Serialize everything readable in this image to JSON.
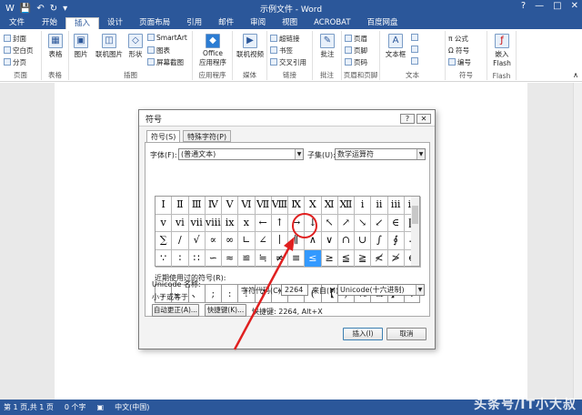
{
  "app": {
    "title": "示例文件 - Word",
    "window_buttons": [
      "?",
      "—",
      "□",
      "✕"
    ]
  },
  "tabs": [
    {
      "label": "文件"
    },
    {
      "label": "开始"
    },
    {
      "label": "插入"
    },
    {
      "label": "设计"
    },
    {
      "label": "页面布局"
    },
    {
      "label": "引用"
    },
    {
      "label": "邮件"
    },
    {
      "label": "审阅"
    },
    {
      "label": "视图"
    },
    {
      "label": "ACROBAT"
    },
    {
      "label": "百度网盘"
    }
  ],
  "ribbon": {
    "pages": {
      "name": "页面",
      "cover": "封面",
      "blank": "空白页",
      "break": "分页"
    },
    "table": {
      "name": "表格",
      "label": "表格"
    },
    "illus": {
      "name": "插图",
      "picture": "图片",
      "online_picture": "联机图片",
      "shapes": "形状",
      "smartart": "SmartArt",
      "chart": "图表",
      "screenshot": "屏幕截图"
    },
    "apps": {
      "name": "应用程序",
      "office": "Office",
      "office2": "应用程序"
    },
    "media": {
      "name": "媒体",
      "online_video": "联机视频"
    },
    "links": {
      "name": "链接",
      "hyperlink": "超链接",
      "bookmark": "书签",
      "crossref": "交叉引用"
    },
    "comments": {
      "name": "批注",
      "comment": "批注"
    },
    "hf": {
      "name": "页眉和页脚",
      "header": "页眉",
      "footer": "页脚",
      "pagenum": "页码"
    },
    "text": {
      "name": "文本",
      "textbox": "文本框"
    },
    "symbols": {
      "name": "符号",
      "equation": "公式",
      "symbol": "符号",
      "number": "编号"
    },
    "flash": {
      "name": "Flash",
      "embed": "嵌入",
      "flash": "Flash"
    }
  },
  "dialog": {
    "title": "符号",
    "help": "?",
    "close": "✕",
    "tab_symbols": "符号(S)",
    "tab_special": "特殊字符(P)",
    "font_label": "字体(F):",
    "font_value": "(普通文本)",
    "subset_label": "子集(U):",
    "subset_value": "数学运算符",
    "grid_rows": [
      [
        "Ⅰ",
        "Ⅱ",
        "Ⅲ",
        "Ⅳ",
        "Ⅴ",
        "Ⅵ",
        "Ⅶ",
        "Ⅷ",
        "Ⅸ",
        "Ⅹ",
        "Ⅺ",
        "Ⅻ",
        "ⅰ",
        "ⅱ",
        "ⅲ",
        "ⅳ"
      ],
      [
        "ⅴ",
        "ⅵ",
        "ⅶ",
        "ⅷ",
        "ⅸ",
        "ⅹ",
        "←",
        "↑",
        "→",
        "↓",
        "↖",
        "↗",
        "↘",
        "↙",
        "∈",
        "∏"
      ],
      [
        "∑",
        "∕",
        "√",
        "∝",
        "∞",
        "∟",
        "∠",
        "∣",
        "∥",
        "∧",
        "∨",
        "∩",
        "∪",
        "∫",
        "∮",
        "∴"
      ],
      [
        "∵",
        "∶",
        "∷",
        "∽",
        "≈",
        "≌",
        "≒",
        "≠",
        "≡",
        "≤",
        "≥",
        "≦",
        "≧",
        "≮",
        "≯",
        "⊕"
      ]
    ],
    "recent_label": "近期使用过的符号(R):",
    "recent": [
      ",",
      "。",
      "、",
      ";",
      ":",
      "!",
      "?",
      "“",
      "”",
      "(",
      "【",
      ")",
      "%",
      "&",
      "】",
      "※"
    ],
    "unicode_name_label": "Unicode 名称:",
    "unicode_name": "小于或等于",
    "charcode_label": "字符代码(C):",
    "charcode": "2264",
    "from_label": "来自(M):",
    "from_value": "Unicode(十六进制)",
    "autocorrect": "自动更正(A)...",
    "shortcut_key": "快捷键(K)...",
    "shortcut_text": "快捷键: 2264, Alt+X",
    "insert": "插入(I)",
    "cancel": "取消"
  },
  "status": {
    "page": "第 1 页,共 1 页",
    "words": "0 个字",
    "lang": "中文(中国)",
    "watermark": "头条号/IT小大叔"
  },
  "colors": {
    "accent": "#2b579a",
    "selection": "#3399ff",
    "annotation": "#e02020"
  }
}
